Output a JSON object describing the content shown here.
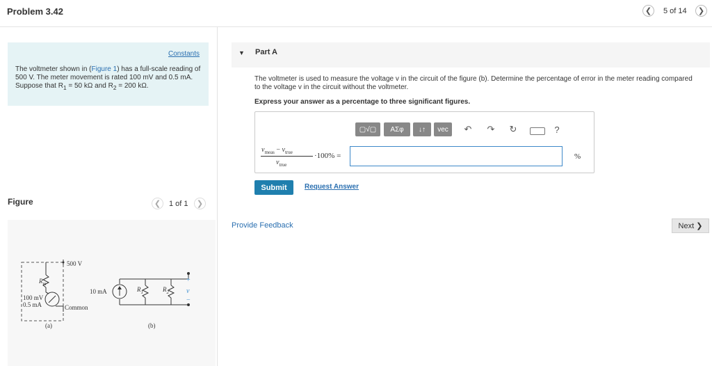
{
  "header": {
    "title": "Problem 3.42",
    "page_counter": "5 of 14",
    "prev_icon": "chevron-left-icon",
    "next_icon": "chevron-right-icon"
  },
  "left": {
    "constants_link": "Constants",
    "problem": {
      "p1": "The voltmeter shown in (",
      "figure_link": "Figure 1",
      "p2": ") has a full-scale reading of 500 V. The meter movement is rated 100 mV and 0.5 mA. Suppose that R",
      "r1_sub": "1",
      "p3": " = 50 kΩ and R",
      "r2_sub": "2",
      "p4": " = 200 kΩ."
    },
    "figure_label": "Figure",
    "figure_pager": "1 of 1",
    "circuit": {
      "a": {
        "v_label": "500 V",
        "rm_label": "R",
        "rm_sub": "m",
        "meter_1": "100 mV",
        "meter_2": "0.5 mA",
        "common": "Common",
        "caption": "(a)"
      },
      "b": {
        "source": "10 mA",
        "r1": "R",
        "r1_sub": "1",
        "r2": "R",
        "r2_sub": "2",
        "plus": "+",
        "v": "v",
        "minus": "−",
        "caption": "(b)"
      }
    }
  },
  "right": {
    "part_title": "Part A",
    "question": "The voltmeter is used to measure the voltage v in the circuit of the figure (b). Determine the percentage of error in the meter reading compared to the voltage v in the circuit without the voltmeter.",
    "instruction": "Express your answer as a percentage to three significant figures.",
    "toolbar": {
      "templates_label": "▢√▢",
      "greek_label": "ΑΣφ",
      "arrows_label": "↓↑",
      "vec_label": "vec",
      "undo_icon": "undo-icon",
      "redo_icon": "redo-icon",
      "reset_icon": "reset-icon",
      "keyboard_icon": "keyboard-icon",
      "help_label": "?"
    },
    "formula": {
      "numerator_v1": "v",
      "numerator_s1": "meas",
      "numerator_op": " − ",
      "numerator_v2": "v",
      "numerator_s2": "true",
      "denominator_v": "v",
      "denominator_s": "true",
      "times_100": "·100% ="
    },
    "answer_value": "",
    "unit": "%",
    "submit_label": "Submit",
    "request_label": "Request Answer",
    "feedback_label": "Provide Feedback",
    "next_label": "Next ❯"
  }
}
